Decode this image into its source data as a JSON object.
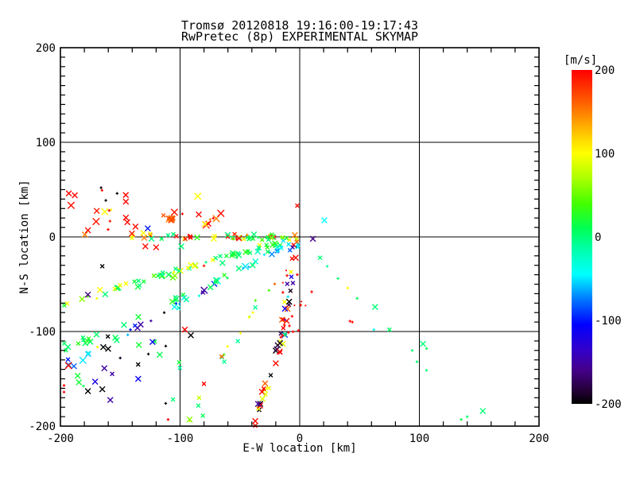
{
  "title": {
    "line1": "Tromsø 20120818 19:16:00-19:17:43",
    "line2": "RwPretec (8p) EXPERIMENTAL SKYMAP"
  },
  "axes": {
    "xlabel": "E-W location [km]",
    "ylabel": "N-S location [km]",
    "xlim": [
      -200,
      200
    ],
    "ylim": [
      -200,
      200
    ],
    "xticks": [
      -200,
      -100,
      0,
      100,
      200
    ],
    "yticks": [
      -200,
      -100,
      0,
      100,
      200
    ],
    "x_minor_step_km": 20,
    "y_minor_step_km": 10,
    "grid": true,
    "grid_at": [
      -100,
      0,
      100
    ]
  },
  "colorbar": {
    "label": "[m/s]",
    "ticks": [
      200,
      100,
      0,
      -100,
      -200
    ],
    "min": -200,
    "max": 200
  },
  "chart_data": {
    "type": "scatter",
    "marker": "x",
    "title": "Tromsø 20120818 19:16:00-19:17:43 RwPretec (8p) EXPERIMENTAL SKYMAP",
    "xlabel": "E-W location [km]",
    "ylabel": "N-S location [km]",
    "xlim": [
      -200,
      200
    ],
    "ylim": [
      -200,
      200
    ],
    "color_is": "line-of-sight velocity [m/s]",
    "colormap_stops": [
      {
        "v": 200,
        "c": "#ff0000"
      },
      {
        "v": 165,
        "c": "#ff5500"
      },
      {
        "v": 140,
        "c": "#ff9900"
      },
      {
        "v": 115,
        "c": "#ffdd00"
      },
      {
        "v": 100,
        "c": "#ffff00"
      },
      {
        "v": 70,
        "c": "#aaff00"
      },
      {
        "v": 40,
        "c": "#44ff00"
      },
      {
        "v": 10,
        "c": "#00ff55"
      },
      {
        "v": -15,
        "c": "#00ffaa"
      },
      {
        "v": -45,
        "c": "#00ffff"
      },
      {
        "v": -75,
        "c": "#0077ff"
      },
      {
        "v": -105,
        "c": "#0000ff"
      },
      {
        "v": -135,
        "c": "#3300cc"
      },
      {
        "v": -160,
        "c": "#440088"
      },
      {
        "v": -185,
        "c": "#220033"
      },
      {
        "v": -200,
        "c": "#000000"
      }
    ],
    "streaks": [
      {
        "name": "y0-band",
        "from": [
          -145,
          1
        ],
        "to": [
          -3,
          0
        ],
        "n": 38,
        "jitter": 3.5,
        "v": [
          195,
          190,
          185,
          150,
          100,
          95,
          60,
          30,
          10,
          0,
          -5,
          100,
          195
        ],
        "sizes": [
          4,
          3,
          3,
          2
        ]
      },
      {
        "name": "y0-apex",
        "from": [
          -55,
          -1
        ],
        "to": [
          -2,
          -2
        ],
        "n": 18,
        "jitter": 2,
        "v": [
          100,
          80,
          60,
          40,
          20,
          10,
          0,
          150
        ],
        "sizes": [
          3,
          3,
          2
        ]
      },
      {
        "name": "green-shallow",
        "from": [
          -8,
          -5
        ],
        "to": [
          -200,
          -73
        ],
        "n": 40,
        "jitter": 4,
        "v": [
          20,
          10,
          0,
          -10,
          30,
          45,
          100,
          95,
          190,
          60,
          -20,
          0,
          10
        ],
        "sizes": [
          4,
          4,
          3,
          2
        ]
      },
      {
        "name": "green-mid",
        "from": [
          -28,
          -9
        ],
        "to": [
          -148,
          -50
        ],
        "n": 24,
        "jitter": 3,
        "v": [
          10,
          0,
          20,
          30,
          -10,
          40,
          100
        ],
        "sizes": [
          4,
          3,
          3
        ]
      },
      {
        "name": "cyan-diagonal",
        "from": [
          -12,
          -9
        ],
        "to": [
          -200,
          -141
        ],
        "n": 38,
        "jitter": 3,
        "v": [
          -40,
          -50,
          -60,
          -70,
          -80,
          -100,
          -30,
          -45,
          -55,
          0,
          10,
          -150,
          -200,
          195
        ],
        "sizes": [
          5,
          4,
          4,
          3,
          2
        ]
      },
      {
        "name": "green-outer",
        "from": [
          -58,
          -40
        ],
        "to": [
          -200,
          -122
        ],
        "n": 20,
        "jitter": 4.5,
        "v": [
          0,
          10,
          20,
          -10,
          30,
          5
        ],
        "sizes": [
          4,
          3,
          3
        ]
      },
      {
        "name": "steep-chain",
        "from": [
          -22,
          -42
        ],
        "to": [
          -95,
          -196
        ],
        "n": 18,
        "jitter": 4,
        "v": [
          100,
          90,
          60,
          40,
          0,
          160,
          200,
          -10,
          80
        ],
        "sizes": [
          2,
          2,
          3
        ]
      },
      {
        "name": "vertical-upper",
        "from": [
          -3,
          -6
        ],
        "to": [
          -15,
          -108
        ],
        "n": 30,
        "jitter": 2.5,
        "v": [
          -200,
          -190,
          -150,
          -100,
          200,
          195,
          160,
          100,
          -50,
          60,
          0,
          -175,
          -120
        ],
        "sizes": [
          4,
          3,
          3,
          2
        ]
      },
      {
        "name": "vertical-lower",
        "from": [
          -15,
          -108
        ],
        "to": [
          -39,
          -200
        ],
        "n": 24,
        "jitter": 2.5,
        "v": [
          -200,
          -150,
          200,
          100,
          160,
          -175,
          90,
          -190,
          195
        ],
        "sizes": [
          4,
          4,
          3
        ]
      }
    ],
    "clouds": [
      {
        "name": "upper-left-red",
        "x": [
          -198,
          -62
        ],
        "y": [
          2,
          50
        ],
        "n": 30,
        "v": [
          200,
          198,
          195,
          192,
          188,
          150,
          100,
          -200
        ],
        "sizes": [
          5,
          4,
          4,
          2
        ]
      },
      {
        "name": "orange-cluster",
        "x": [
          -114,
          -105
        ],
        "y": [
          17,
          25
        ],
        "n": 7,
        "v": [
          165,
          160,
          170,
          155
        ],
        "sizes": [
          4,
          3
        ]
      },
      {
        "name": "red-sprinkle",
        "x": [
          -18,
          8
        ],
        "y": [
          -115,
          -20
        ],
        "n": 18,
        "v": [
          200,
          198,
          195
        ],
        "sizes": [
          2,
          2,
          1
        ]
      },
      {
        "name": "deep-left",
        "x": [
          -198,
          -95
        ],
        "y": [
          -175,
          -100
        ],
        "n": 20,
        "v": [
          0,
          10,
          -10,
          20,
          -200,
          100,
          200,
          -150,
          -100,
          60,
          5
        ],
        "sizes": [
          4,
          3,
          2
        ]
      },
      {
        "name": "origin-blue",
        "x": [
          -20,
          -8
        ],
        "y": [
          -20,
          -4
        ],
        "n": 8,
        "v": [
          -50,
          -80,
          -100,
          -160,
          -40
        ],
        "sizes": [
          3,
          3,
          2
        ]
      }
    ],
    "points": [
      [
        11,
        -2,
        -160,
        4
      ],
      [
        20.6,
        17.6,
        -45,
        4
      ],
      [
        17,
        -22,
        0,
        3
      ],
      [
        23,
        -31,
        -10,
        2
      ],
      [
        32,
        -44,
        5,
        2
      ],
      [
        40,
        -54,
        100,
        2
      ],
      [
        10,
        -58,
        200,
        2
      ],
      [
        48,
        -65,
        10,
        2
      ],
      [
        63,
        -74,
        0,
        4
      ],
      [
        42,
        -89,
        195,
        2
      ],
      [
        62,
        -98,
        -40,
        2
      ],
      [
        75,
        -98,
        5,
        3
      ],
      [
        103,
        -113,
        0,
        4
      ],
      [
        106,
        -118,
        10,
        2
      ],
      [
        94,
        -120,
        0,
        2
      ],
      [
        98,
        -132,
        5,
        2
      ],
      [
        106,
        -141,
        0,
        2
      ],
      [
        153,
        -184,
        0,
        4
      ],
      [
        135,
        -193,
        10,
        2
      ],
      [
        140,
        -190,
        5,
        2
      ],
      [
        -127,
        9,
        -100,
        4
      ],
      [
        -99,
        -10,
        0,
        4
      ],
      [
        -165,
        -31,
        -200,
        3
      ],
      [
        -166,
        52,
        -195,
        2
      ],
      [
        44,
        -90,
        195,
        2
      ],
      [
        -177,
        -61,
        -160,
        4
      ],
      [
        -167,
        -56,
        100,
        4
      ],
      [
        -91,
        -104,
        -200,
        4
      ],
      [
        -96,
        -98,
        200,
        4
      ],
      [
        -150,
        -128,
        -190,
        2
      ],
      [
        -112,
        -176,
        -195,
        2
      ],
      [
        -110,
        -193,
        200,
        2
      ],
      [
        -92,
        -193,
        60,
        4
      ],
      [
        -81,
        -189,
        10,
        3
      ],
      [
        -197,
        -157,
        200,
        2
      ],
      [
        -197,
        -164,
        200,
        2
      ],
      [
        -171,
        -153,
        -120,
        4
      ],
      [
        -165,
        -161,
        -200,
        4
      ],
      [
        -177,
        -163,
        -200,
        4
      ],
      [
        -135,
        -150,
        -110,
        4
      ],
      [
        -123,
        -111,
        -110,
        4
      ],
      [
        -2,
        33,
        195,
        3
      ],
      [
        -120,
        -11,
        195,
        4
      ],
      [
        -129,
        -10,
        195,
        4
      ],
      [
        -177,
        7,
        195,
        4
      ],
      [
        -193,
        46,
        198,
        4
      ],
      [
        -188,
        44,
        198,
        4
      ]
    ]
  }
}
